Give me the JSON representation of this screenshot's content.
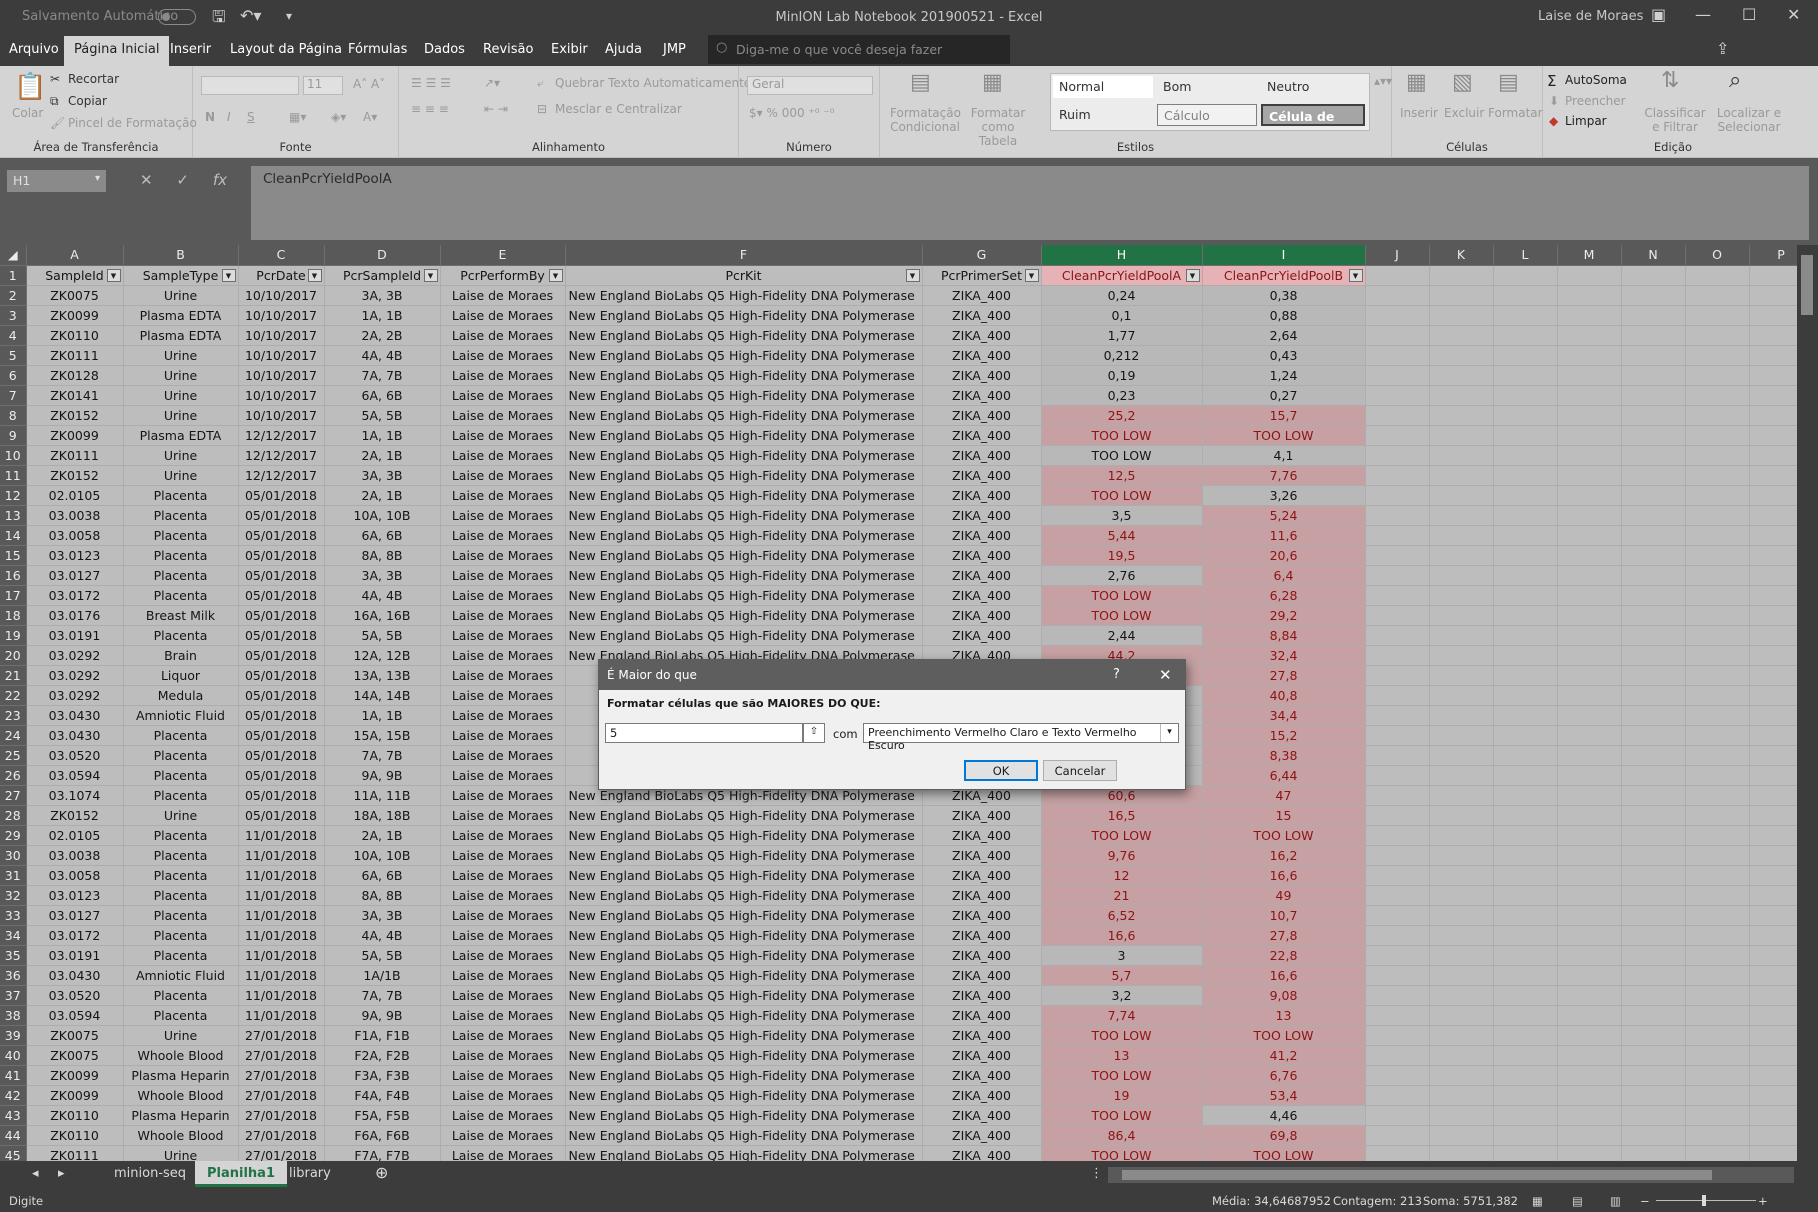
{
  "titlebar": {
    "autosave_label": "Salvamento Automático",
    "document_title": "MinION Lab Notebook 201900521  -  Excel",
    "user": "Laise de Moraes",
    "icons": [
      "save-icon",
      "undo-icon",
      "customize-icon"
    ]
  },
  "menu": {
    "tabs": [
      "Arquivo",
      "Página Inicial",
      "Inserir",
      "Layout da Página",
      "Fórmulas",
      "Dados",
      "Revisão",
      "Exibir",
      "Ajuda",
      "JMP"
    ],
    "active_tab": "Página Inicial",
    "tell_me_placeholder": "Diga-me o que você deseja fazer"
  },
  "ribbon": {
    "clipboard": {
      "paste": "Colar",
      "cut": "Recortar",
      "copy": "Copiar",
      "format_painter": "Pincel de Formatação",
      "label": "Área de Transferência"
    },
    "font": {
      "size": "11",
      "bold": "N",
      "italic": "I",
      "underline": "S",
      "label": "Fonte"
    },
    "alignment": {
      "wrap_text": "Quebrar Texto Automaticamente",
      "merge_center": "Mesclar e Centralizar",
      "label": "Alinhamento"
    },
    "number": {
      "format": "Geral",
      "label": "Número"
    },
    "styles": {
      "conditional_formatting": "Formatação Condicional",
      "format_as_table": "Formatar como Tabela",
      "items": [
        "Normal",
        "Bom",
        "Neutro",
        "Ruim",
        "Cálculo",
        "Célula de Ve..."
      ],
      "label": "Estilos"
    },
    "cells": {
      "insert": "Inserir",
      "delete": "Excluir",
      "format": "Formatar",
      "label": "Células"
    },
    "editing": {
      "autosum": "AutoSoma",
      "fill": "Preencher",
      "clear": "Limpar",
      "sort_filter": "Classificar e Filtrar",
      "find_select": "Localizar e Selecionar",
      "label": "Edição"
    }
  },
  "formula_bar": {
    "name_box": "H1",
    "content": "CleanPcrYieldPoolA"
  },
  "grid": {
    "columns": [
      "A",
      "B",
      "C",
      "D",
      "E",
      "F",
      "G",
      "H",
      "I",
      "J",
      "K",
      "L",
      "M",
      "N",
      "O",
      "P"
    ],
    "headers": [
      "SampleId",
      "SampleType",
      "PcrDate",
      "PcrSampleId",
      "PcrPerformBy",
      "PcrKit",
      "PcrPrimerSet",
      "CleanPcrYieldPoolA",
      "CleanPcrYieldPoolB"
    ],
    "rows": [
      [
        "ZK0075",
        "Urine",
        "10/10/2017",
        "3A, 3B",
        "Laise de Moraes",
        "New England BioLabs Q5 High-Fidelity DNA Polymerase",
        "ZIKA_400",
        "0,24",
        "0,38"
      ],
      [
        "ZK0099",
        "Plasma EDTA",
        "10/10/2017",
        "1A, 1B",
        "Laise de Moraes",
        "New England BioLabs Q5 High-Fidelity DNA Polymerase",
        "ZIKA_400",
        "0,1",
        "0,88"
      ],
      [
        "ZK0110",
        "Plasma EDTA",
        "10/10/2017",
        "2A, 2B",
        "Laise de Moraes",
        "New England BioLabs Q5 High-Fidelity DNA Polymerase",
        "ZIKA_400",
        "1,77",
        "2,64"
      ],
      [
        "ZK0111",
        "Urine",
        "10/10/2017",
        "4A, 4B",
        "Laise de Moraes",
        "New England BioLabs Q5 High-Fidelity DNA Polymerase",
        "ZIKA_400",
        "0,212",
        "0,43"
      ],
      [
        "ZK0128",
        "Urine",
        "10/10/2017",
        "7A, 7B",
        "Laise de Moraes",
        "New England BioLabs Q5 High-Fidelity DNA Polymerase",
        "ZIKA_400",
        "0,19",
        "1,24"
      ],
      [
        "ZK0141",
        "Urine",
        "10/10/2017",
        "6A, 6B",
        "Laise de Moraes",
        "New England BioLabs Q5 High-Fidelity DNA Polymerase",
        "ZIKA_400",
        "0,23",
        "0,27"
      ],
      [
        "ZK0152",
        "Urine",
        "10/10/2017",
        "5A, 5B",
        "Laise de Moraes",
        "New England BioLabs Q5 High-Fidelity DNA Polymerase",
        "ZIKA_400",
        "25,2",
        "15,7"
      ],
      [
        "ZK0099",
        "Plasma EDTA",
        "12/12/2017",
        "1A, 1B",
        "Laise de Moraes",
        "New England BioLabs Q5 High-Fidelity DNA Polymerase",
        "ZIKA_400",
        "TOO LOW",
        "TOO LOW"
      ],
      [
        "ZK0111",
        "Urine",
        "12/12/2017",
        "2A, 1B",
        "Laise de Moraes",
        "New England BioLabs Q5 High-Fidelity DNA Polymerase",
        "ZIKA_400",
        "TOO LOW",
        "4,1"
      ],
      [
        "ZK0152",
        "Urine",
        "12/12/2017",
        "3A, 3B",
        "Laise de Moraes",
        "New England BioLabs Q5 High-Fidelity DNA Polymerase",
        "ZIKA_400",
        "12,5",
        "7,76"
      ],
      [
        "02.0105",
        "Placenta",
        "05/01/2018",
        "2A, 1B",
        "Laise de Moraes",
        "New England BioLabs Q5 High-Fidelity DNA Polymerase",
        "ZIKA_400",
        "TOO LOW",
        "3,26"
      ],
      [
        "03.0038",
        "Placenta",
        "05/01/2018",
        "10A, 10B",
        "Laise de Moraes",
        "New England BioLabs Q5 High-Fidelity DNA Polymerase",
        "ZIKA_400",
        "3,5",
        "5,24"
      ],
      [
        "03.0058",
        "Placenta",
        "05/01/2018",
        "6A, 6B",
        "Laise de Moraes",
        "New England BioLabs Q5 High-Fidelity DNA Polymerase",
        "ZIKA_400",
        "5,44",
        "11,6"
      ],
      [
        "03.0123",
        "Placenta",
        "05/01/2018",
        "8A, 8B",
        "Laise de Moraes",
        "New England BioLabs Q5 High-Fidelity DNA Polymerase",
        "ZIKA_400",
        "19,5",
        "20,6"
      ],
      [
        "03.0127",
        "Placenta",
        "05/01/2018",
        "3A, 3B",
        "Laise de Moraes",
        "New England BioLabs Q5 High-Fidelity DNA Polymerase",
        "ZIKA_400",
        "2,76",
        "6,4"
      ],
      [
        "03.0172",
        "Placenta",
        "05/01/2018",
        "4A, 4B",
        "Laise de Moraes",
        "New England BioLabs Q5 High-Fidelity DNA Polymerase",
        "ZIKA_400",
        "TOO LOW",
        "6,28"
      ],
      [
        "03.0176",
        "Breast Milk",
        "05/01/2018",
        "16A, 16B",
        "Laise de Moraes",
        "New England BioLabs Q5 High-Fidelity DNA Polymerase",
        "ZIKA_400",
        "TOO LOW",
        "29,2"
      ],
      [
        "03.0191",
        "Placenta",
        "05/01/2018",
        "5A, 5B",
        "Laise de Moraes",
        "New England BioLabs Q5 High-Fidelity DNA Polymerase",
        "ZIKA_400",
        "2,44",
        "8,84"
      ],
      [
        "03.0292",
        "Brain",
        "05/01/2018",
        "12A, 12B",
        "Laise de Moraes",
        "New England BioLabs Q5 High-Fidelity DNA Polymerase",
        "ZIKA_400",
        "44,2",
        "32,4"
      ],
      [
        "03.0292",
        "Liquor",
        "05/01/2018",
        "13A, 13B",
        "Laise de Moraes",
        "New",
        "",
        "",
        "27,8"
      ],
      [
        "03.0292",
        "Medula",
        "05/01/2018",
        "14A, 14B",
        "Laise de Moraes",
        "New",
        "",
        "",
        "40,8"
      ],
      [
        "03.0430",
        "Amniotic Fluid",
        "05/01/2018",
        "1A, 1B",
        "Laise de Moraes",
        "New",
        "",
        "",
        "34,4"
      ],
      [
        "03.0430",
        "Placenta",
        "05/01/2018",
        "15A, 15B",
        "Laise de Moraes",
        "New",
        "",
        "",
        "15,2"
      ],
      [
        "03.0520",
        "Placenta",
        "05/01/2018",
        "7A, 7B",
        "Laise de Moraes",
        "New",
        "",
        "",
        "8,38"
      ],
      [
        "03.0594",
        "Placenta",
        "05/01/2018",
        "9A, 9B",
        "Laise de Moraes",
        "New",
        "",
        "",
        "6,44"
      ],
      [
        "03.1074",
        "Placenta",
        "05/01/2018",
        "11A, 11B",
        "Laise de Moraes",
        "New England BioLabs Q5 High-Fidelity DNA Polymerase",
        "ZIKA_400",
        "60,6",
        "47"
      ],
      [
        "ZK0152",
        "Urine",
        "05/01/2018",
        "18A, 18B",
        "Laise de Moraes",
        "New England BioLabs Q5 High-Fidelity DNA Polymerase",
        "ZIKA_400",
        "16,5",
        "15"
      ],
      [
        "02.0105",
        "Placenta",
        "11/01/2018",
        "2A, 1B",
        "Laise de Moraes",
        "New England BioLabs Q5 High-Fidelity DNA Polymerase",
        "ZIKA_400",
        "TOO LOW",
        "TOO LOW"
      ],
      [
        "03.0038",
        "Placenta",
        "11/01/2018",
        "10A, 10B",
        "Laise de Moraes",
        "New England BioLabs Q5 High-Fidelity DNA Polymerase",
        "ZIKA_400",
        "9,76",
        "16,2"
      ],
      [
        "03.0058",
        "Placenta",
        "11/01/2018",
        "6A, 6B",
        "Laise de Moraes",
        "New England BioLabs Q5 High-Fidelity DNA Polymerase",
        "ZIKA_400",
        "12",
        "16,6"
      ],
      [
        "03.0123",
        "Placenta",
        "11/01/2018",
        "8A, 8B",
        "Laise de Moraes",
        "New England BioLabs Q5 High-Fidelity DNA Polymerase",
        "ZIKA_400",
        "21",
        "49"
      ],
      [
        "03.0127",
        "Placenta",
        "11/01/2018",
        "3A, 3B",
        "Laise de Moraes",
        "New England BioLabs Q5 High-Fidelity DNA Polymerase",
        "ZIKA_400",
        "6,52",
        "10,7"
      ],
      [
        "03.0172",
        "Placenta",
        "11/01/2018",
        "4A, 4B",
        "Laise de Moraes",
        "New England BioLabs Q5 High-Fidelity DNA Polymerase",
        "ZIKA_400",
        "16,6",
        "27,8"
      ],
      [
        "03.0191",
        "Placenta",
        "11/01/2018",
        "5A, 5B",
        "Laise de Moraes",
        "New England BioLabs Q5 High-Fidelity DNA Polymerase",
        "ZIKA_400",
        "3",
        "22,8"
      ],
      [
        "03.0430",
        "Amniotic Fluid",
        "11/01/2018",
        "1A/1B",
        "Laise de Moraes",
        "New England BioLabs Q5 High-Fidelity DNA Polymerase",
        "ZIKA_400",
        "5,7",
        "16,6"
      ],
      [
        "03.0520",
        "Placenta",
        "11/01/2018",
        "7A, 7B",
        "Laise de Moraes",
        "New England BioLabs Q5 High-Fidelity DNA Polymerase",
        "ZIKA_400",
        "3,2",
        "9,08"
      ],
      [
        "03.0594",
        "Placenta",
        "11/01/2018",
        "9A, 9B",
        "Laise de Moraes",
        "New England BioLabs Q5 High-Fidelity DNA Polymerase",
        "ZIKA_400",
        "7,74",
        "13"
      ],
      [
        "ZK0075",
        "Urine",
        "27/01/2018",
        "F1A, F1B",
        "Laise de Moraes",
        "New England BioLabs Q5 High-Fidelity DNA Polymerase",
        "ZIKA_400",
        "TOO LOW",
        "TOO LOW"
      ],
      [
        "ZK0075",
        "Whoole Blood",
        "27/01/2018",
        "F2A, F2B",
        "Laise de Moraes",
        "New England BioLabs Q5 High-Fidelity DNA Polymerase",
        "ZIKA_400",
        "13",
        "41,2"
      ],
      [
        "ZK0099",
        "Plasma Heparin",
        "27/01/2018",
        "F3A, F3B",
        "Laise de Moraes",
        "New England BioLabs Q5 High-Fidelity DNA Polymerase",
        "ZIKA_400",
        "TOO LOW",
        "6,76"
      ],
      [
        "ZK0099",
        "Whoole Blood",
        "27/01/2018",
        "F4A, F4B",
        "Laise de Moraes",
        "New England BioLabs Q5 High-Fidelity DNA Polymerase",
        "ZIKA_400",
        "19",
        "53,4"
      ],
      [
        "ZK0110",
        "Plasma Heparin",
        "27/01/2018",
        "F5A, F5B",
        "Laise de Moraes",
        "New England BioLabs Q5 High-Fidelity DNA Polymerase",
        "ZIKA_400",
        "TOO LOW",
        "4,46"
      ],
      [
        "ZK0110",
        "Whoole Blood",
        "27/01/2018",
        "F6A, F6B",
        "Laise de Moraes",
        "New England BioLabs Q5 High-Fidelity DNA Polymerase",
        "ZIKA_400",
        "86,4",
        "69,8"
      ],
      [
        "ZK0111",
        "Urine",
        "27/01/2018",
        "F7A, F7B",
        "Laise de Moraes",
        "New England BioLabs Q5 High-Fidelity DNA Polymerase",
        "ZIKA_400",
        "TOO LOW",
        "TOO LOW"
      ]
    ],
    "highlighted_cells": {
      "H": [
        8,
        9,
        11,
        12,
        14,
        15,
        17,
        18,
        20,
        21,
        27,
        28,
        29,
        30,
        31,
        32,
        33,
        34,
        36,
        38,
        39,
        40,
        41,
        42,
        43,
        44,
        45
      ],
      "I": [
        8,
        9,
        11,
        13,
        14,
        15,
        16,
        17,
        18,
        19,
        20,
        21,
        22,
        23,
        24,
        25,
        26,
        27,
        28,
        29,
        30,
        31,
        32,
        33,
        34,
        35,
        36,
        37,
        38,
        39,
        40,
        41,
        42,
        44,
        45
      ]
    },
    "highlight_color": "#c6a0a3",
    "highlight_text_color": "#8b1414",
    "selected_columns": [
      "H",
      "I"
    ]
  },
  "sheets": {
    "tabs": [
      "minion-seq",
      "Planilha1",
      "library"
    ],
    "active": "Planilha1"
  },
  "status": {
    "mode": "Digite",
    "average": "Média: 34,64687952",
    "count": "Contagem: 213",
    "sum": "Soma: 5751,382"
  },
  "dialog": {
    "title": "É Maior do que",
    "label": "Formatar células que são MAIORES DO QUE:",
    "value": "5",
    "with_label": "com",
    "format_option": "Preenchimento Vermelho Claro e Texto Vermelho Escuro",
    "ok": "OK",
    "cancel": "Cancelar",
    "help": "?",
    "close": "✕"
  }
}
